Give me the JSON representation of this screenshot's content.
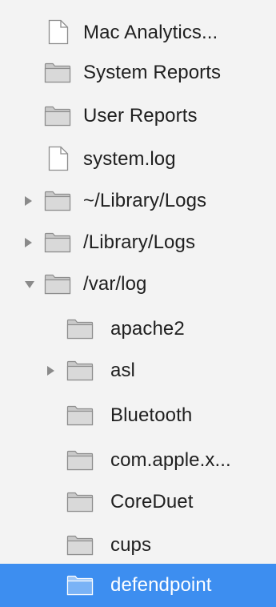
{
  "sidebar": {
    "items": [
      {
        "label": "Mac Analytics...",
        "icon": "document-icon",
        "level": 0,
        "disclosure": "none",
        "selected": false
      },
      {
        "label": "System Reports",
        "icon": "folder-icon",
        "level": 0,
        "disclosure": "none",
        "selected": false
      },
      {
        "label": "User Reports",
        "icon": "folder-icon",
        "level": 0,
        "disclosure": "none",
        "selected": false
      },
      {
        "label": "system.log",
        "icon": "document-icon",
        "level": 0,
        "disclosure": "none",
        "selected": false
      },
      {
        "label": "~/Library/Logs",
        "icon": "folder-icon",
        "level": 0,
        "disclosure": "closed",
        "selected": false
      },
      {
        "label": "/Library/Logs",
        "icon": "folder-icon",
        "level": 0,
        "disclosure": "closed",
        "selected": false
      },
      {
        "label": "/var/log",
        "icon": "folder-icon",
        "level": 0,
        "disclosure": "open",
        "selected": false
      },
      {
        "label": "apache2",
        "icon": "folder-icon",
        "level": 1,
        "disclosure": "none",
        "selected": false
      },
      {
        "label": "asl",
        "icon": "folder-icon",
        "level": 1,
        "disclosure": "closed",
        "selected": false
      },
      {
        "label": "Bluetooth",
        "icon": "folder-icon",
        "level": 1,
        "disclosure": "none",
        "selected": false
      },
      {
        "label": "com.apple.x...",
        "icon": "folder-icon",
        "level": 1,
        "disclosure": "none",
        "selected": false
      },
      {
        "label": "CoreDuet",
        "icon": "folder-icon",
        "level": 1,
        "disclosure": "none",
        "selected": false
      },
      {
        "label": "cups",
        "icon": "folder-icon",
        "level": 1,
        "disclosure": "none",
        "selected": false
      },
      {
        "label": "defendpoint",
        "icon": "folder-icon",
        "level": 1,
        "disclosure": "none",
        "selected": true
      }
    ]
  },
  "colors": {
    "sidebar_bg": "#f3f3f3",
    "selection": "#3d8ef0",
    "text": "#1f1f1f",
    "selected_text": "#ffffff"
  }
}
